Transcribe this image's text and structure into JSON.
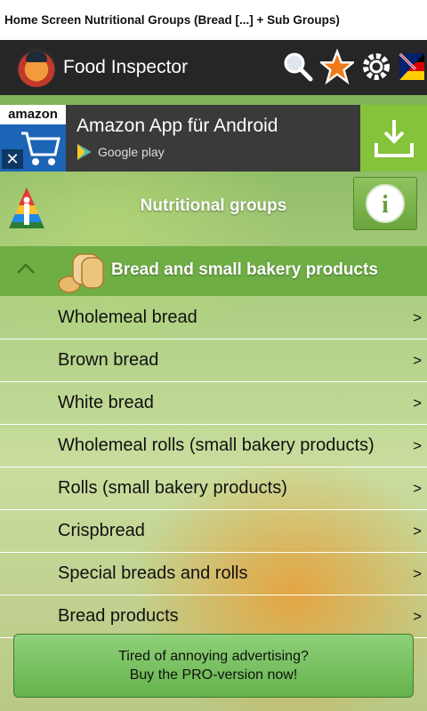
{
  "caption": "Home Screen Nutritional Groups (Bread [...] + Sub Groups)",
  "actionbar": {
    "title": "Food Inspector",
    "icons": [
      "search-icon",
      "star-icon",
      "settings-icon",
      "language-flag-icon"
    ]
  },
  "ad": {
    "brand": "amazon",
    "title": "Amazon App für Android",
    "store": "Google play"
  },
  "nutritional_groups": {
    "title": "Nutritional groups",
    "info_icon": "i"
  },
  "category": {
    "label": "Bread and small bakery products",
    "expanded_icon": "chevron-up-icon"
  },
  "subgroups": [
    {
      "label": "Wholemeal bread",
      "arrow": ">"
    },
    {
      "label": "Brown bread",
      "arrow": ">"
    },
    {
      "label": "White bread",
      "arrow": ">"
    },
    {
      "label": "Wholemeal rolls (small bakery products)",
      "arrow": ">"
    },
    {
      "label": "Rolls (small bakery products)",
      "arrow": ">"
    },
    {
      "label": "Crispbread",
      "arrow": ">"
    },
    {
      "label": "Special breads and rolls",
      "arrow": ">"
    },
    {
      "label": "Bread products",
      "arrow": ">"
    }
  ],
  "pro_banner": {
    "line1": "Tired of annoying advertising?",
    "line2": "Buy the PRO-version now!"
  },
  "colors": {
    "actionbar": "#262626",
    "category_bg": "#6fae45",
    "ad_download": "#85c33a",
    "accent_star": "#f07a1a"
  }
}
